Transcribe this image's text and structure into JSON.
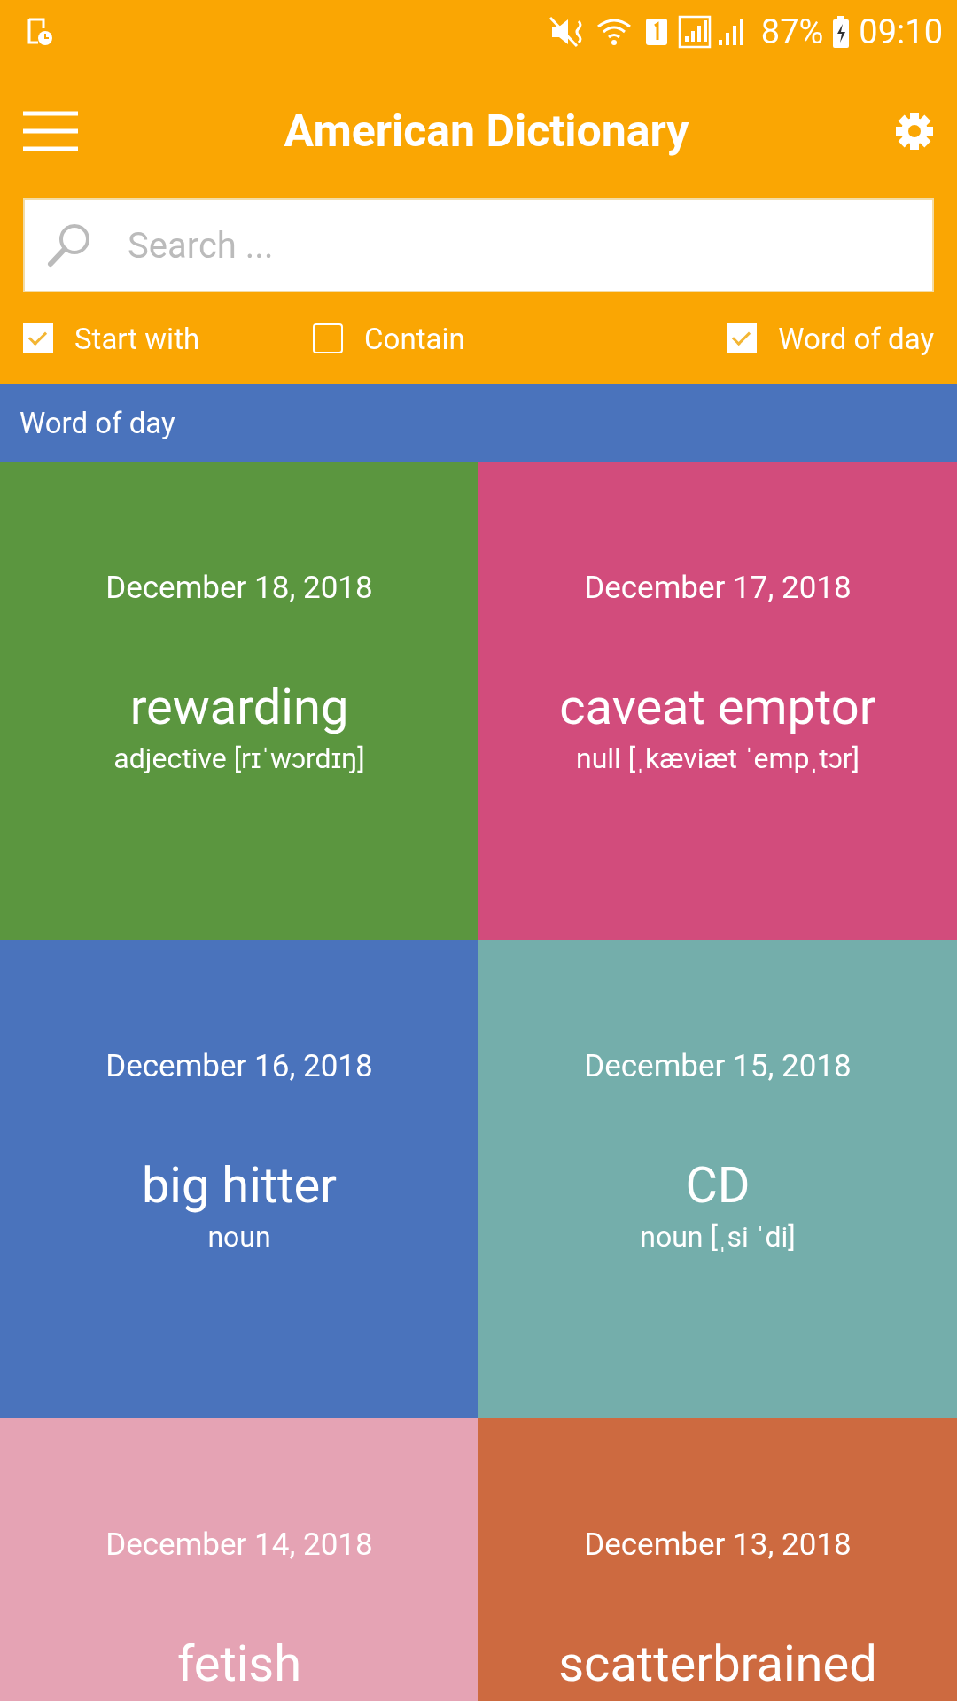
{
  "status_bar": {
    "battery": "87%",
    "time": "09:10"
  },
  "app_bar": {
    "title": "American Dictionary"
  },
  "search": {
    "placeholder": "Search ..."
  },
  "filters": [
    {
      "label": "Start with",
      "checked": true
    },
    {
      "label": "Contain",
      "checked": false
    },
    {
      "label": "Word of day",
      "checked": true
    }
  ],
  "section": {
    "title": "Word of day"
  },
  "words": [
    {
      "date": "December 18, 2018",
      "word": "rewarding",
      "detail": "adjective [rɪˈwɔrdɪŋ]",
      "color": "#5b963f"
    },
    {
      "date": "December 17, 2018",
      "word": "caveat emptor",
      "detail": "null [ˌkæviæt ˈempˌtɔr]",
      "color": "#d24c7c"
    },
    {
      "date": "December 16, 2018",
      "word": "big hitter",
      "detail": "noun",
      "color": "#4a73bc"
    },
    {
      "date": "December 15, 2018",
      "word": "CD",
      "detail": "noun [ˌsi ˈdi]",
      "color": "#74aeab"
    },
    {
      "date": "December 14, 2018",
      "word": "fetish",
      "color": "#e5a3b4"
    },
    {
      "date": "December 13, 2018",
      "word": "scatterbrained",
      "color": "#cd6a40"
    }
  ]
}
